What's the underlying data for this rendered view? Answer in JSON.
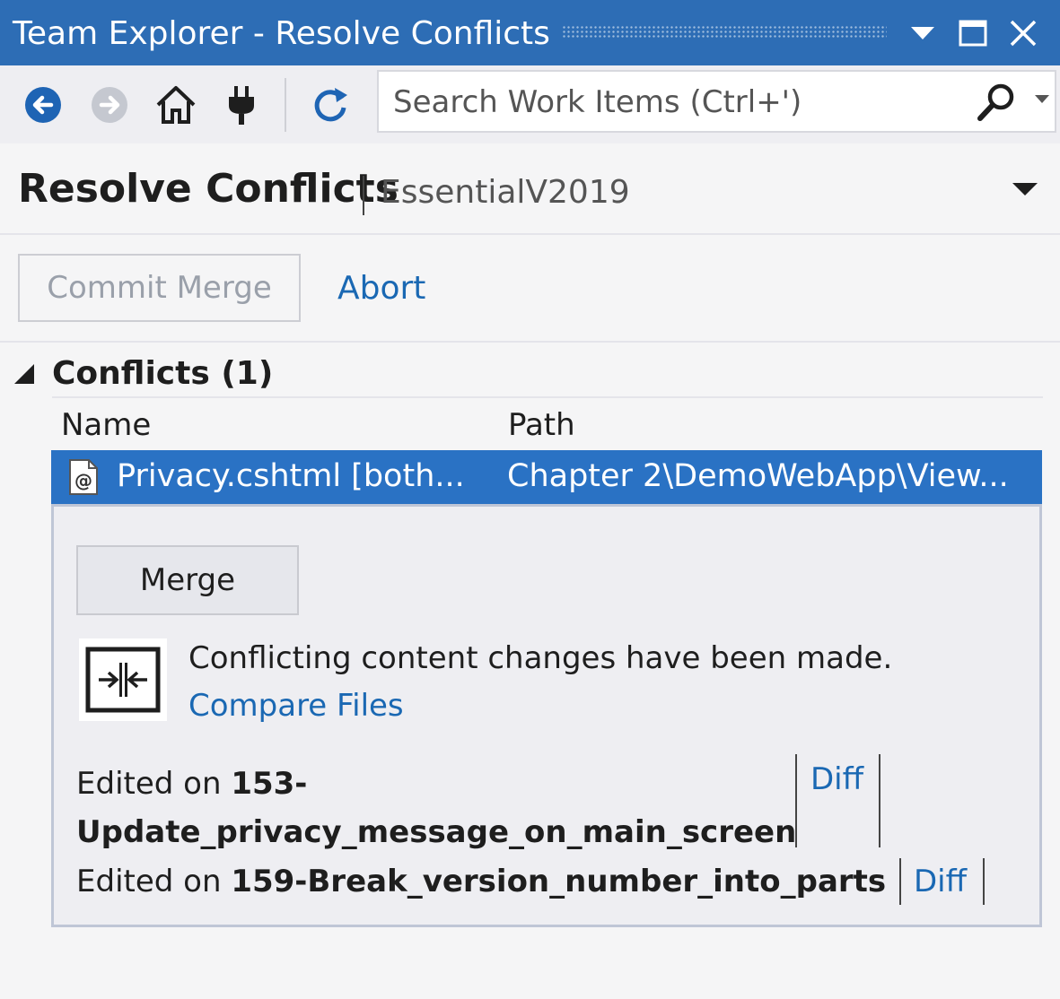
{
  "window": {
    "title": "Team Explorer - Resolve Conflicts",
    "controls": [
      "dropdown-icon",
      "maximize-icon",
      "close-icon"
    ]
  },
  "toolbar": {
    "icons": [
      "back-arrow-icon",
      "forward-arrow-icon",
      "home-icon",
      "connect-plug-icon",
      "refresh-icon"
    ],
    "search": {
      "placeholder": "Search Work Items (Ctrl+')",
      "value": ""
    }
  },
  "header": {
    "title": "Resolve Conflicts",
    "repository": "EssentialV2019"
  },
  "actions": {
    "commit_label": "Commit Merge",
    "abort_label": "Abort"
  },
  "conflicts": {
    "section_title": "Conflicts (1)",
    "columns": {
      "name": "Name",
      "path": "Path"
    },
    "rows": [
      {
        "name": "Privacy.cshtml [both...",
        "path": "Chapter 2\\DemoWebApp\\View..."
      }
    ]
  },
  "detail": {
    "merge_label": "Merge",
    "message": "Conflicting content changes have been made.",
    "compare_label": "Compare Files",
    "edits": [
      {
        "prefix": "Edited on ",
        "branch_line1": "153-",
        "branch_line2": "Update_privacy_message_on_main_screen",
        "diff_label": "Diff"
      },
      {
        "prefix": "Edited on ",
        "branch": "159-Break_version_number_into_parts",
        "diff_label": "Diff"
      }
    ]
  },
  "colors": {
    "titlebar": "#2d6db5",
    "selection": "#2a72c4",
    "link": "#1a68b3"
  }
}
